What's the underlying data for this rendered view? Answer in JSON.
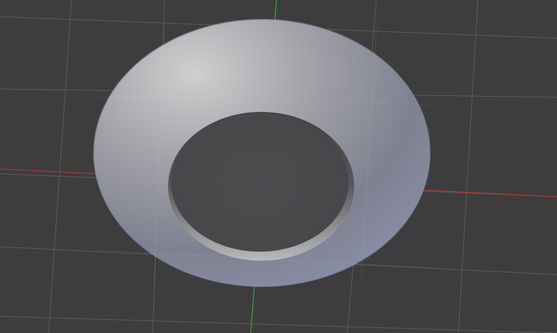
{
  "viewport": {
    "background": "#3d3d3d",
    "grid_color": "#5a5a5a",
    "x_axis_color": "#b03535",
    "y_axis_color": "#3aa43a"
  },
  "object": {
    "type": "bowl-mesh",
    "rim_highlight": "#c7c7c9",
    "outer_shade": "#8d8f98",
    "inner_floor": "#4a4a4c",
    "rim_tint": "#8a8ea8"
  }
}
